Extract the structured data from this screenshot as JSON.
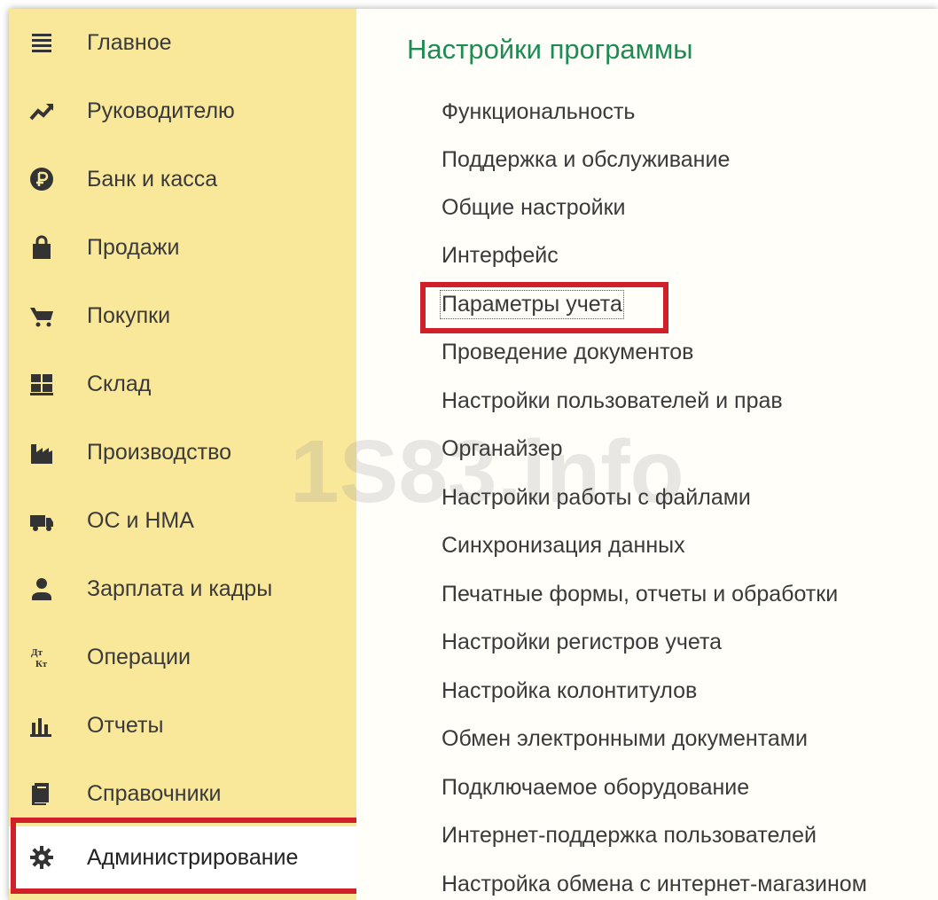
{
  "sidebar": {
    "items": [
      {
        "label": "Главное",
        "icon": "menu-lines-icon"
      },
      {
        "label": "Руководителю",
        "icon": "trend-up-icon"
      },
      {
        "label": "Банк и касса",
        "icon": "ruble-coin-icon"
      },
      {
        "label": "Продажи",
        "icon": "shopping-bag-icon"
      },
      {
        "label": "Покупки",
        "icon": "cart-icon"
      },
      {
        "label": "Склад",
        "icon": "warehouse-grid-icon"
      },
      {
        "label": "Производство",
        "icon": "factory-icon"
      },
      {
        "label": "ОС и НМА",
        "icon": "truck-icon"
      },
      {
        "label": "Зарплата и кадры",
        "icon": "person-icon"
      },
      {
        "label": "Операции",
        "icon": "debit-credit-icon"
      },
      {
        "label": "Отчеты",
        "icon": "bar-chart-icon"
      },
      {
        "label": "Справочники",
        "icon": "books-icon"
      },
      {
        "label": "Администрирование",
        "icon": "gear-icon"
      }
    ],
    "selected_index": 12
  },
  "main": {
    "title": "Настройки программы",
    "links": [
      "Функциональность",
      "Поддержка и обслуживание",
      "Общие настройки",
      "Интерфейс",
      "Параметры учета",
      "Проведение документов",
      "Настройки пользователей и прав",
      "Органайзер",
      "Настройки работы с файлами",
      "Синхронизация данных",
      "Печатные формы, отчеты и обработки",
      "Настройки регистров учета",
      "Настройка колонтитулов",
      "Обмен электронными документами",
      "Подключаемое оборудование",
      "Интернет-поддержка пользователей",
      "Настройка обмена с интернет-магазином"
    ],
    "focused_index": 4
  },
  "watermark": "1S83.info",
  "colors": {
    "sidebar_bg": "#f9e79a",
    "title_green": "#1d8b53",
    "highlight_red": "#d2202a",
    "text": "#3a3a3a"
  }
}
